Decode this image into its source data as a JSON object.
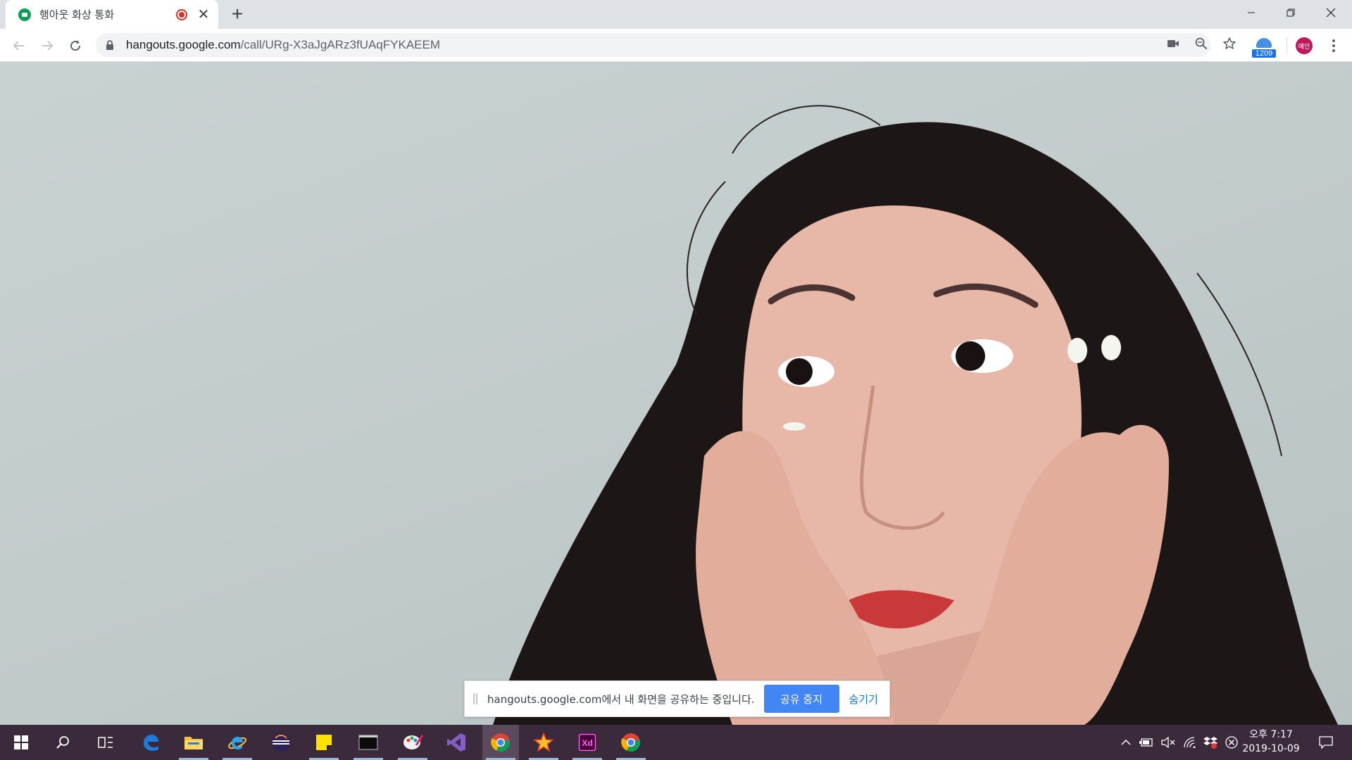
{
  "browser": {
    "tab": {
      "title": "행아웃 화상 통화"
    },
    "address": {
      "domain": "hangouts.google.com",
      "path": "/call/URg-X3aJgARz3fUAqFYKAEEM"
    },
    "extension_badge_count": "1209",
    "profile_label": "예인"
  },
  "sharebar": {
    "message": "hangouts.google.com에서 내 화면을 공유하는 중입니다.",
    "stop_label": "공유 중지",
    "hide_label": "숨기기"
  },
  "taskbar": {
    "apps": [
      "start",
      "search",
      "task-view",
      "edge",
      "file-explorer",
      "internet-explorer",
      "eclipse",
      "sticky-notes",
      "terminal",
      "paint",
      "visual-studio",
      "chrome",
      "star-app",
      "adobe-xd",
      "chrome"
    ],
    "clock": {
      "time": "오후 7:17",
      "date": "2019-10-09"
    }
  },
  "colors": {
    "accent": "#4285f4",
    "recording": "#d93025",
    "taskbar": "#3a2a3c"
  }
}
